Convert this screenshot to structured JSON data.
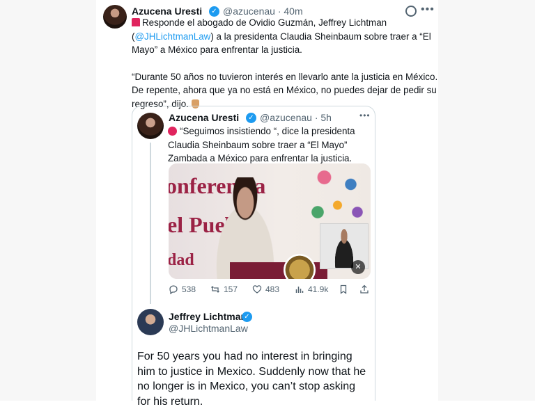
{
  "main_tweet": {
    "author_name": "Azucena Uresti",
    "author_handle": "@azucenau",
    "separator": "·",
    "time": "40m",
    "line1_pre": "Responde el abogado de Ovidio Guzmán, Jeffrey Lichtman (",
    "mention": "@JHLichtmanLaw",
    "line1_post": ") a la presidenta Claudia Sheinbaum sobre traer a “El Mayo” a México para enfrentar la justicia.",
    "paragraph2": "“Durante 50 años no tuvieron interés en llevarlo ante la justicia en México. De repente, ahora que ya no está en México, no puedes dejar de pedir su regreso”, dijo."
  },
  "quoted_tweet": {
    "author_name": "Azucena Uresti",
    "author_handle": "@azucenau",
    "separator": "·",
    "time": "5h",
    "text": "“Seguimos insistiendo “, dice la presidenta Claudia Sheinbaum sobre traer a “El Mayo” Zambada a México para enfrentar la justicia.",
    "media_text": [
      "onferencia",
      "el Pueb",
      "dad"
    ],
    "metrics": {
      "replies": "538",
      "reposts": "157",
      "likes": "483",
      "views": "41.9k"
    }
  },
  "reply_card": {
    "author_name": "Jeffrey Lichtman",
    "author_handle": "@JHLichtmanLaw",
    "text": "For 50 years you had no interest in bringing him to justice in Mexico. Suddenly now that he no longer is in Mexico, you can’t stop asking for his return."
  },
  "colors": {
    "accent": "#1d9bf0",
    "text": "#0f1419",
    "muted": "#536471",
    "border": "#cfd9de",
    "side_bg": "#f7f7f7"
  }
}
